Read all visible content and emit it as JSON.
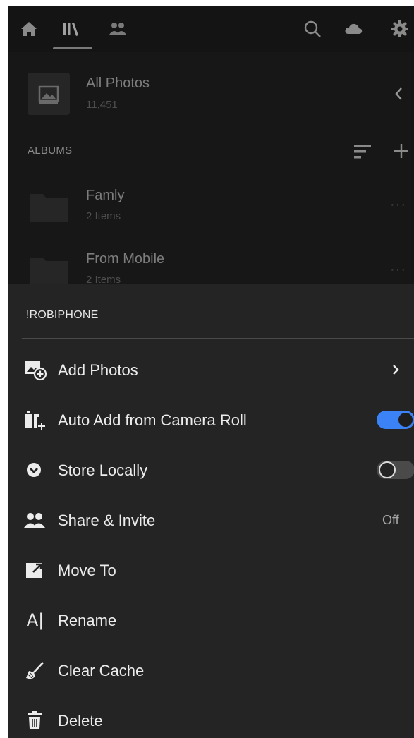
{
  "library": {
    "all_photos": {
      "label": "All Photos",
      "count": "11,451"
    },
    "albums_header": "ALBUMS",
    "albums": [
      {
        "name": "Famly",
        "items": "2 Items"
      },
      {
        "name": "From Mobile",
        "items": "2 Items"
      }
    ]
  },
  "sheet": {
    "title": "!ROBIPHONE",
    "rows": [
      {
        "label": "Add Photos",
        "icon": "add-photos-icon",
        "accessory": "chevron"
      },
      {
        "label": "Auto Add from Camera Roll",
        "icon": "camera-roll-icon",
        "accessory": "toggle",
        "toggle_on": true
      },
      {
        "label": "Store Locally",
        "icon": "download-circle-icon",
        "accessory": "toggle",
        "toggle_on": false
      },
      {
        "label": "Share & Invite",
        "icon": "people-icon",
        "accessory": "value",
        "value": "Off"
      },
      {
        "label": "Move To",
        "icon": "move-to-icon"
      },
      {
        "label": "Rename",
        "icon": "rename-icon",
        "icon_text": "A|"
      },
      {
        "label": "Clear Cache",
        "icon": "broom-icon"
      },
      {
        "label": "Delete",
        "icon": "trash-icon"
      }
    ]
  },
  "colors": {
    "accent": "#3b82f6",
    "sheet_bg": "#242424",
    "text": "#ececec"
  }
}
